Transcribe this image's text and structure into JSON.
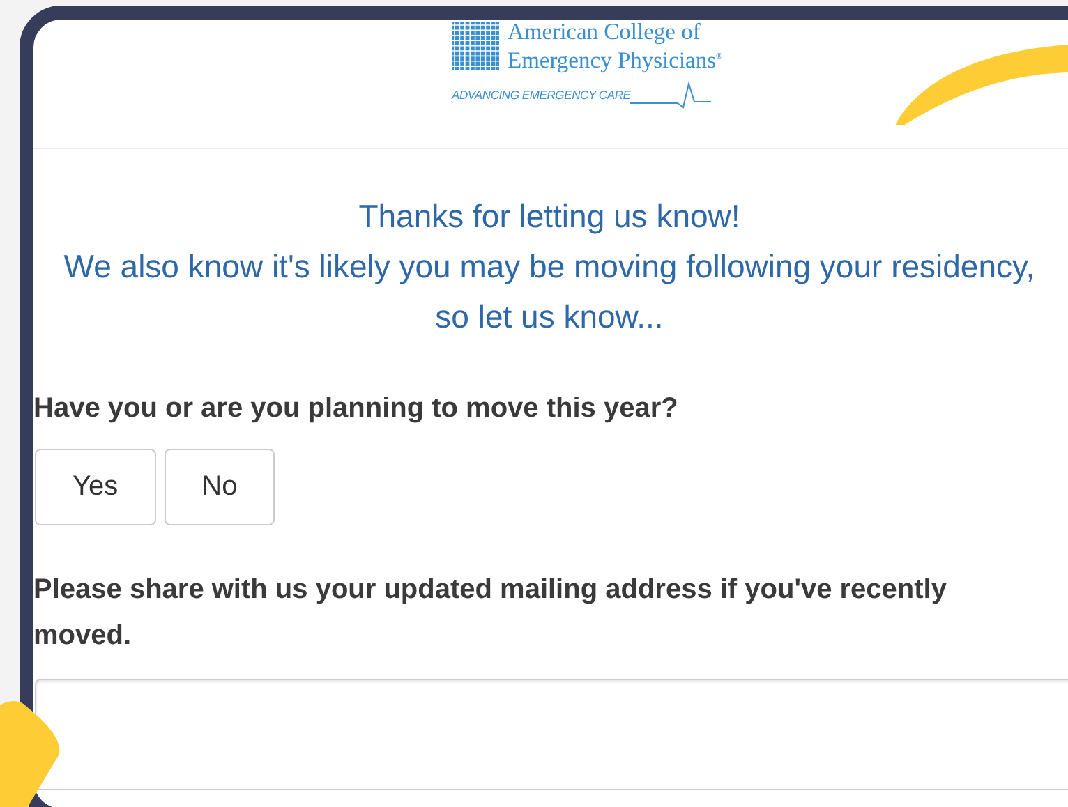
{
  "logo": {
    "line_1": "American College of",
    "line_2": "Emergency Physicians",
    "mark": "®",
    "tagline": "ADVANCING EMERGENCY CARE"
  },
  "message": [
    "Thanks for letting us know!",
    "We also know it's likely you may be moving following your residency, so let us know..."
  ],
  "question": {
    "label": "Have you or are you planning to move this year?",
    "options": [
      {
        "label": "Yes",
        "selected": false
      },
      {
        "label": "No",
        "selected": false
      }
    ]
  },
  "address": {
    "label": "Please share with us your updated mailing address if you've recently moved."
  }
}
